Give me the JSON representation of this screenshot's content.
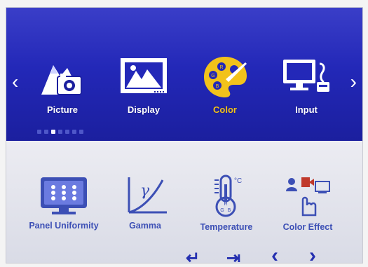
{
  "menu": {
    "left_arrow": "‹",
    "right_arrow": "›",
    "tiles": [
      {
        "label": "Picture",
        "icon": "picture-icon"
      },
      {
        "label": "Display",
        "icon": "display-icon"
      },
      {
        "label": "Color",
        "icon": "palette-icon",
        "selected": true
      },
      {
        "label": "Input",
        "icon": "input-icon"
      }
    ],
    "page_dots": [
      false,
      false,
      true,
      false,
      false,
      false,
      false
    ]
  },
  "submenu": {
    "items": [
      {
        "label": "Panel Uniformity",
        "icon": "panel-grid-icon"
      },
      {
        "label": "Gamma",
        "icon": "gamma-curve-icon"
      },
      {
        "label": "Temperature",
        "icon": "thermometer-icon"
      },
      {
        "label": "Color Effect",
        "icon": "color-effect-icon"
      }
    ]
  },
  "nav": {
    "enter": "↵",
    "exit": "⇥",
    "prev": "‹",
    "next": "›"
  },
  "colors": {
    "accent": "#f2c21b",
    "band_top": "#2328b8",
    "submenu_text": "#3c4fb5"
  }
}
